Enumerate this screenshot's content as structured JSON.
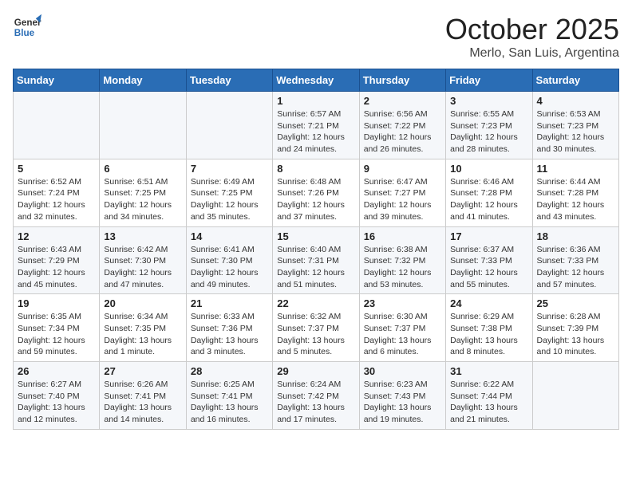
{
  "logo": {
    "line1": "General",
    "line2": "Blue"
  },
  "title": "October 2025",
  "subtitle": "Merlo, San Luis, Argentina",
  "weekdays": [
    "Sunday",
    "Monday",
    "Tuesday",
    "Wednesday",
    "Thursday",
    "Friday",
    "Saturday"
  ],
  "weeks": [
    [
      {
        "day": "",
        "detail": ""
      },
      {
        "day": "",
        "detail": ""
      },
      {
        "day": "",
        "detail": ""
      },
      {
        "day": "1",
        "detail": "Sunrise: 6:57 AM\nSunset: 7:21 PM\nDaylight: 12 hours\nand 24 minutes."
      },
      {
        "day": "2",
        "detail": "Sunrise: 6:56 AM\nSunset: 7:22 PM\nDaylight: 12 hours\nand 26 minutes."
      },
      {
        "day": "3",
        "detail": "Sunrise: 6:55 AM\nSunset: 7:23 PM\nDaylight: 12 hours\nand 28 minutes."
      },
      {
        "day": "4",
        "detail": "Sunrise: 6:53 AM\nSunset: 7:23 PM\nDaylight: 12 hours\nand 30 minutes."
      }
    ],
    [
      {
        "day": "5",
        "detail": "Sunrise: 6:52 AM\nSunset: 7:24 PM\nDaylight: 12 hours\nand 32 minutes."
      },
      {
        "day": "6",
        "detail": "Sunrise: 6:51 AM\nSunset: 7:25 PM\nDaylight: 12 hours\nand 34 minutes."
      },
      {
        "day": "7",
        "detail": "Sunrise: 6:49 AM\nSunset: 7:25 PM\nDaylight: 12 hours\nand 35 minutes."
      },
      {
        "day": "8",
        "detail": "Sunrise: 6:48 AM\nSunset: 7:26 PM\nDaylight: 12 hours\nand 37 minutes."
      },
      {
        "day": "9",
        "detail": "Sunrise: 6:47 AM\nSunset: 7:27 PM\nDaylight: 12 hours\nand 39 minutes."
      },
      {
        "day": "10",
        "detail": "Sunrise: 6:46 AM\nSunset: 7:28 PM\nDaylight: 12 hours\nand 41 minutes."
      },
      {
        "day": "11",
        "detail": "Sunrise: 6:44 AM\nSunset: 7:28 PM\nDaylight: 12 hours\nand 43 minutes."
      }
    ],
    [
      {
        "day": "12",
        "detail": "Sunrise: 6:43 AM\nSunset: 7:29 PM\nDaylight: 12 hours\nand 45 minutes."
      },
      {
        "day": "13",
        "detail": "Sunrise: 6:42 AM\nSunset: 7:30 PM\nDaylight: 12 hours\nand 47 minutes."
      },
      {
        "day": "14",
        "detail": "Sunrise: 6:41 AM\nSunset: 7:30 PM\nDaylight: 12 hours\nand 49 minutes."
      },
      {
        "day": "15",
        "detail": "Sunrise: 6:40 AM\nSunset: 7:31 PM\nDaylight: 12 hours\nand 51 minutes."
      },
      {
        "day": "16",
        "detail": "Sunrise: 6:38 AM\nSunset: 7:32 PM\nDaylight: 12 hours\nand 53 minutes."
      },
      {
        "day": "17",
        "detail": "Sunrise: 6:37 AM\nSunset: 7:33 PM\nDaylight: 12 hours\nand 55 minutes."
      },
      {
        "day": "18",
        "detail": "Sunrise: 6:36 AM\nSunset: 7:33 PM\nDaylight: 12 hours\nand 57 minutes."
      }
    ],
    [
      {
        "day": "19",
        "detail": "Sunrise: 6:35 AM\nSunset: 7:34 PM\nDaylight: 12 hours\nand 59 minutes."
      },
      {
        "day": "20",
        "detail": "Sunrise: 6:34 AM\nSunset: 7:35 PM\nDaylight: 13 hours\nand 1 minute."
      },
      {
        "day": "21",
        "detail": "Sunrise: 6:33 AM\nSunset: 7:36 PM\nDaylight: 13 hours\nand 3 minutes."
      },
      {
        "day": "22",
        "detail": "Sunrise: 6:32 AM\nSunset: 7:37 PM\nDaylight: 13 hours\nand 5 minutes."
      },
      {
        "day": "23",
        "detail": "Sunrise: 6:30 AM\nSunset: 7:37 PM\nDaylight: 13 hours\nand 6 minutes."
      },
      {
        "day": "24",
        "detail": "Sunrise: 6:29 AM\nSunset: 7:38 PM\nDaylight: 13 hours\nand 8 minutes."
      },
      {
        "day": "25",
        "detail": "Sunrise: 6:28 AM\nSunset: 7:39 PM\nDaylight: 13 hours\nand 10 minutes."
      }
    ],
    [
      {
        "day": "26",
        "detail": "Sunrise: 6:27 AM\nSunset: 7:40 PM\nDaylight: 13 hours\nand 12 minutes."
      },
      {
        "day": "27",
        "detail": "Sunrise: 6:26 AM\nSunset: 7:41 PM\nDaylight: 13 hours\nand 14 minutes."
      },
      {
        "day": "28",
        "detail": "Sunrise: 6:25 AM\nSunset: 7:41 PM\nDaylight: 13 hours\nand 16 minutes."
      },
      {
        "day": "29",
        "detail": "Sunrise: 6:24 AM\nSunset: 7:42 PM\nDaylight: 13 hours\nand 17 minutes."
      },
      {
        "day": "30",
        "detail": "Sunrise: 6:23 AM\nSunset: 7:43 PM\nDaylight: 13 hours\nand 19 minutes."
      },
      {
        "day": "31",
        "detail": "Sunrise: 6:22 AM\nSunset: 7:44 PM\nDaylight: 13 hours\nand 21 minutes."
      },
      {
        "day": "",
        "detail": ""
      }
    ]
  ]
}
